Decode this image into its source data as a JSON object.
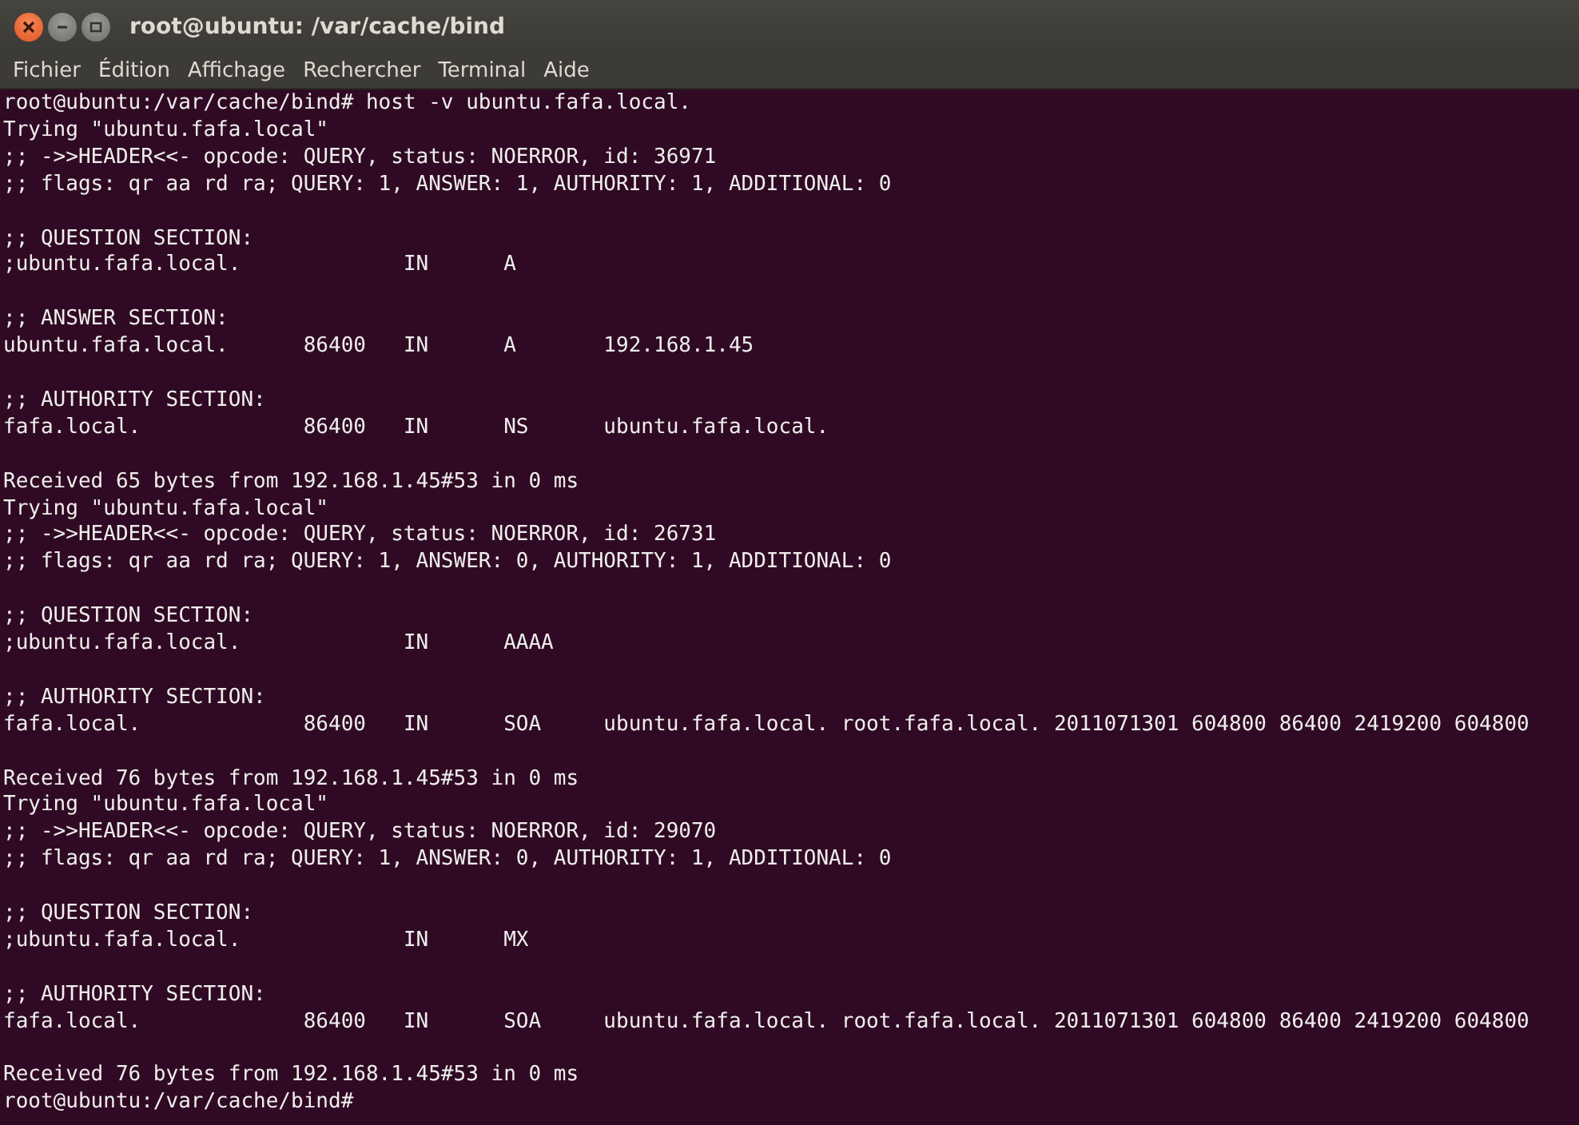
{
  "window": {
    "title": "root@ubuntu: /var/cache/bind"
  },
  "menu": [
    "Fichier",
    "Édition",
    "Affichage",
    "Rechercher",
    "Terminal",
    "Aide"
  ],
  "terminal": {
    "blocks": [
      [
        "root@ubuntu:/var/cache/bind# host -v ubuntu.fafa.local.",
        "Trying \"ubuntu.fafa.local\"",
        ";; ->>HEADER<<- opcode: QUERY, status: NOERROR, id: 36971",
        ";; flags: qr aa rd ra; QUERY: 1, ANSWER: 1, AUTHORITY: 1, ADDITIONAL: 0"
      ],
      [
        ";; QUESTION SECTION:",
        ";ubuntu.fafa.local.             IN      A"
      ],
      [
        ";; ANSWER SECTION:",
        "ubuntu.fafa.local.      86400   IN      A       192.168.1.45"
      ],
      [
        ";; AUTHORITY SECTION:",
        "fafa.local.             86400   IN      NS      ubuntu.fafa.local."
      ],
      [
        "Received 65 bytes from 192.168.1.45#53 in 0 ms",
        "Trying \"ubuntu.fafa.local\"",
        ";; ->>HEADER<<- opcode: QUERY, status: NOERROR, id: 26731",
        ";; flags: qr aa rd ra; QUERY: 1, ANSWER: 0, AUTHORITY: 1, ADDITIONAL: 0"
      ],
      [
        ";; QUESTION SECTION:",
        ";ubuntu.fafa.local.             IN      AAAA"
      ],
      [
        ";; AUTHORITY SECTION:",
        "fafa.local.             86400   IN      SOA     ubuntu.fafa.local. root.fafa.local. 2011071301 604800 86400 2419200 604800"
      ],
      [
        "Received 76 bytes from 192.168.1.45#53 in 0 ms",
        "Trying \"ubuntu.fafa.local\"",
        ";; ->>HEADER<<- opcode: QUERY, status: NOERROR, id: 29070",
        ";; flags: qr aa rd ra; QUERY: 1, ANSWER: 0, AUTHORITY: 1, ADDITIONAL: 0"
      ],
      [
        ";; QUESTION SECTION:",
        ";ubuntu.fafa.local.             IN      MX"
      ],
      [
        ";; AUTHORITY SECTION:",
        "fafa.local.             86400   IN      SOA     ubuntu.fafa.local. root.fafa.local. 2011071301 604800 86400 2419200 604800"
      ],
      [
        "Received 76 bytes from 192.168.1.45#53 in 0 ms",
        "root@ubuntu:/var/cache/bind#"
      ]
    ]
  }
}
